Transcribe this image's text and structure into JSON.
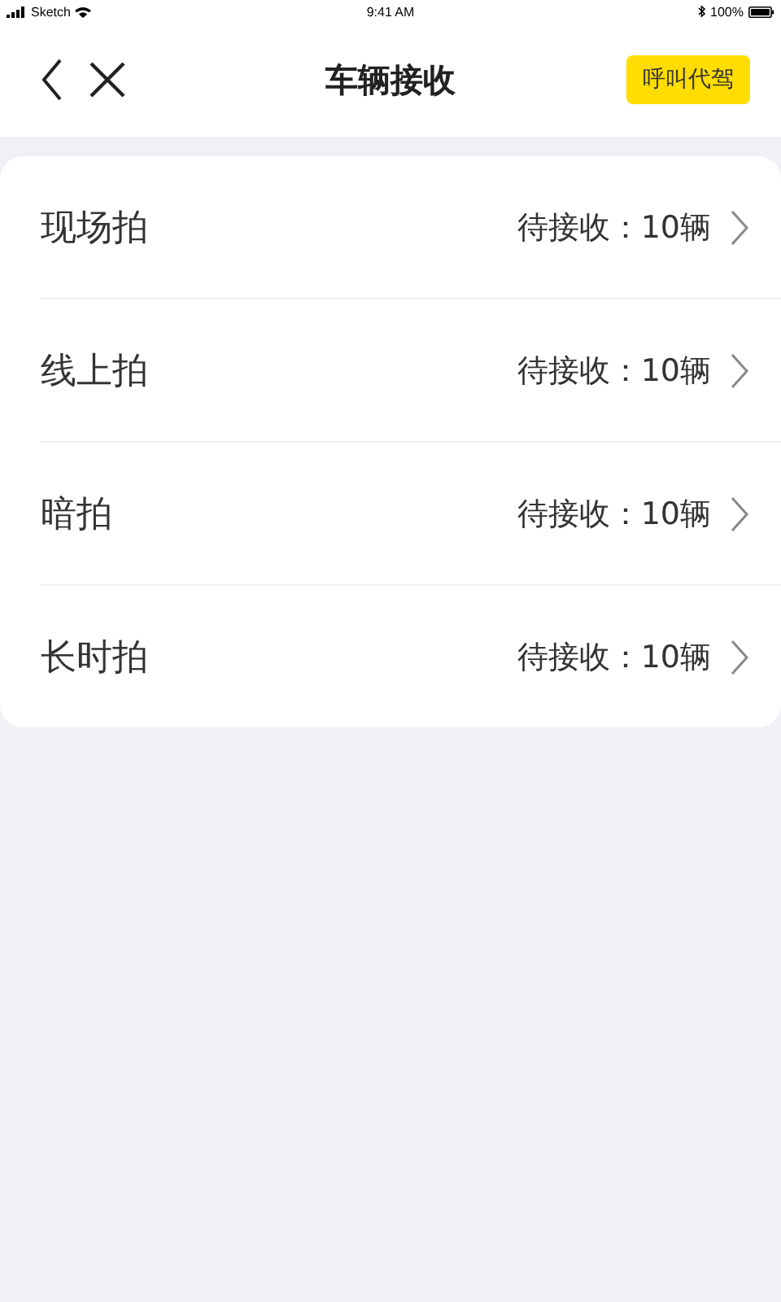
{
  "status_bar": {
    "carrier": "Sketch",
    "time": "9:41 AM",
    "battery": "100%"
  },
  "header": {
    "title": "车辆接收",
    "action": "呼叫代驾"
  },
  "items": [
    {
      "label": "现场拍",
      "status": "待接收：10辆"
    },
    {
      "label": "线上拍",
      "status": "待接收：10辆"
    },
    {
      "label": "暗拍",
      "status": "待接收：10辆"
    },
    {
      "label": "长时拍",
      "status": "待接收：10辆"
    }
  ]
}
